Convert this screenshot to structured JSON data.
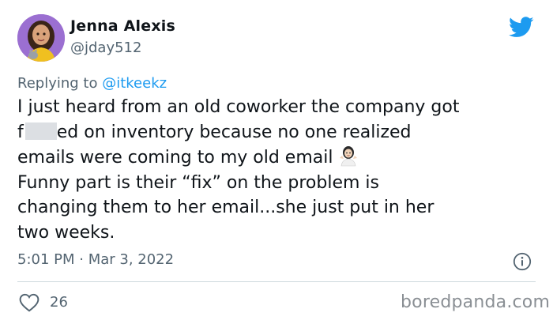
{
  "author": {
    "name": "Jenna Alexis",
    "handle": "@jday512",
    "avatar_icon": "bitmoji-avatar",
    "avatar_bg": "#9b6fd1"
  },
  "platform_icon": "twitter-bird-icon",
  "brand_color": "#1d9bf0",
  "reply": {
    "prefix": "Replying to ",
    "user": "@itkeekz"
  },
  "tweet": {
    "line1": "I just heard from an old coworker the company got",
    "line2_start": "f",
    "line2_end": "ed on inventory because no one realized",
    "line3": "emails were coming to my old email",
    "emoji": "person-shrugging-emoji",
    "line4": "Funny part is their “fix” on the problem is",
    "line5": "changing them to her email...she just put in her",
    "line6": "two weeks."
  },
  "timestamp": "5:01 PM · Mar 3, 2022",
  "info_icon": "info-icon",
  "likes": {
    "count": "26",
    "icon": "heart-icon"
  },
  "watermark": "boredpanda.com"
}
